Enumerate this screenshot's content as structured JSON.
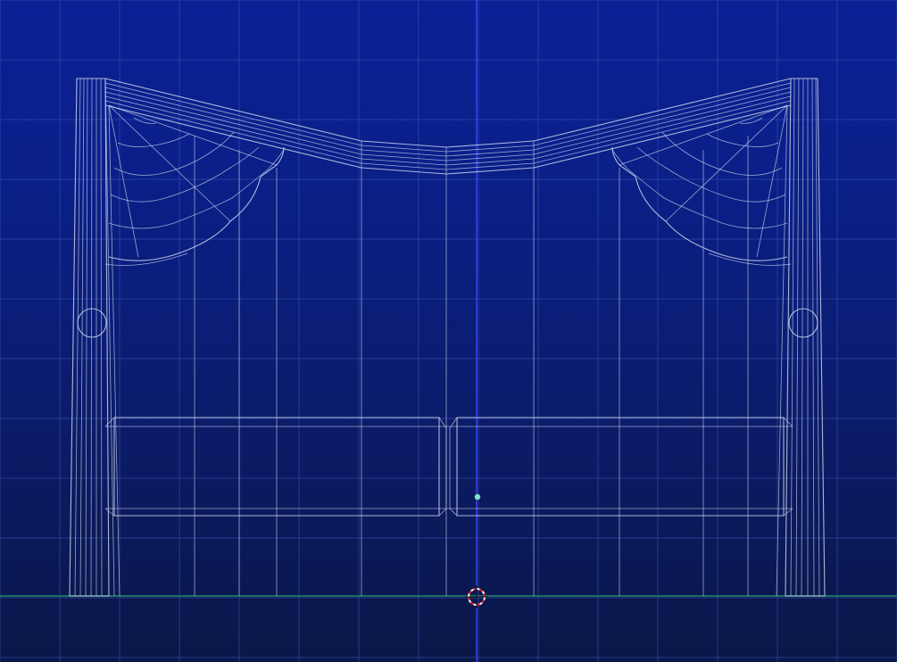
{
  "viewport": {
    "view": "front",
    "shading": "wireframe",
    "background_top": "#0b2095",
    "background_bottom": "#0a1748",
    "grid_color": "#3a57b8",
    "wire_color": "#c9d2ea",
    "ground_axis_color": "#1f8a6b",
    "vertical_axis_color": "#3b44ff"
  },
  "object": {
    "name": "gate-arch-with-cobwebs",
    "origin_color": "#7fe3c8"
  },
  "cursor": {
    "icon": "3d-cursor-icon",
    "ring_color": "#d9202a",
    "ring_alt_color": "#ffffff"
  }
}
